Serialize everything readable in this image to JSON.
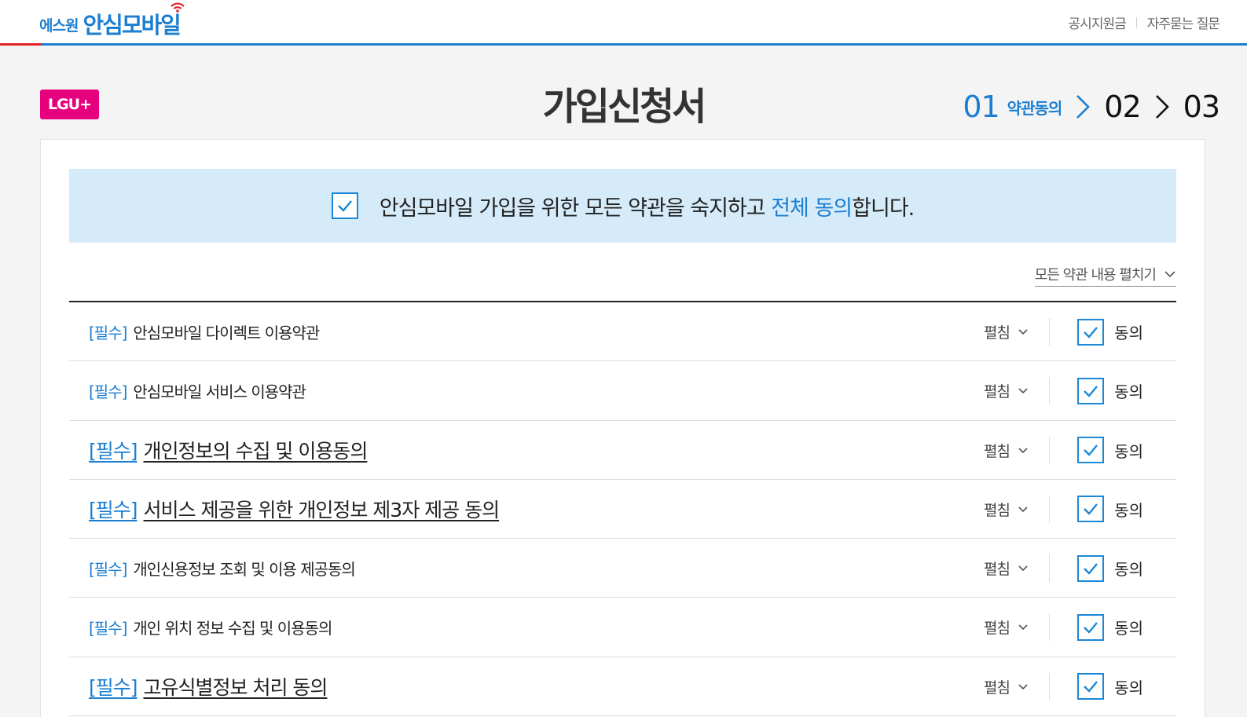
{
  "header": {
    "logo_prefix": "에스원",
    "logo_brand": "안심모바일",
    "links": [
      "공시지원금",
      "자주묻는 질문"
    ]
  },
  "carrier_badge": "LGU+",
  "page_title": "가입신청서",
  "steps": {
    "current_num": "01",
    "current_label": "약관동의",
    "next": [
      "02",
      "03"
    ]
  },
  "agree_all": {
    "text_before": "안심모바일 가입을 위한 모든 약관을 숙지하고 ",
    "text_highlight": "전체 동의",
    "text_after": "합니다.",
    "checked": true
  },
  "expand_all_label": "모든 약관 내용 펼치기",
  "terms": [
    {
      "tag": "[필수]",
      "title": "안심모바일 다이렉트 이용약관",
      "toggle": "펼침",
      "agree": "동의"
    },
    {
      "tag": "[필수]",
      "title": "안심모바일 서비스 이용약관",
      "toggle": "펼침",
      "agree": "동의"
    },
    {
      "tag": "[필수]",
      "title": "개인정보의 수집 및 이용동의",
      "toggle": "펼침",
      "agree": "동의"
    },
    {
      "tag": "[필수]",
      "title": "서비스 제공을 위한 개인정보 제3자 제공 동의",
      "toggle": "펼침",
      "agree": "동의"
    },
    {
      "tag": "[필수]",
      "title": "개인신용정보 조회 및 이용 제공동의",
      "toggle": "펼침",
      "agree": "동의"
    },
    {
      "tag": "[필수]",
      "title": "개인 위치 정보 수집 및 이용동의",
      "toggle": "펼침",
      "agree": "동의"
    },
    {
      "tag": "[필수]",
      "title": "고유식별정보 처리 동의",
      "toggle": "펼침",
      "agree": "동의"
    }
  ],
  "colors": {
    "accent": "#1b7ed1",
    "carrier": "#e6007e",
    "agree_bg": "#d6ebf9"
  }
}
